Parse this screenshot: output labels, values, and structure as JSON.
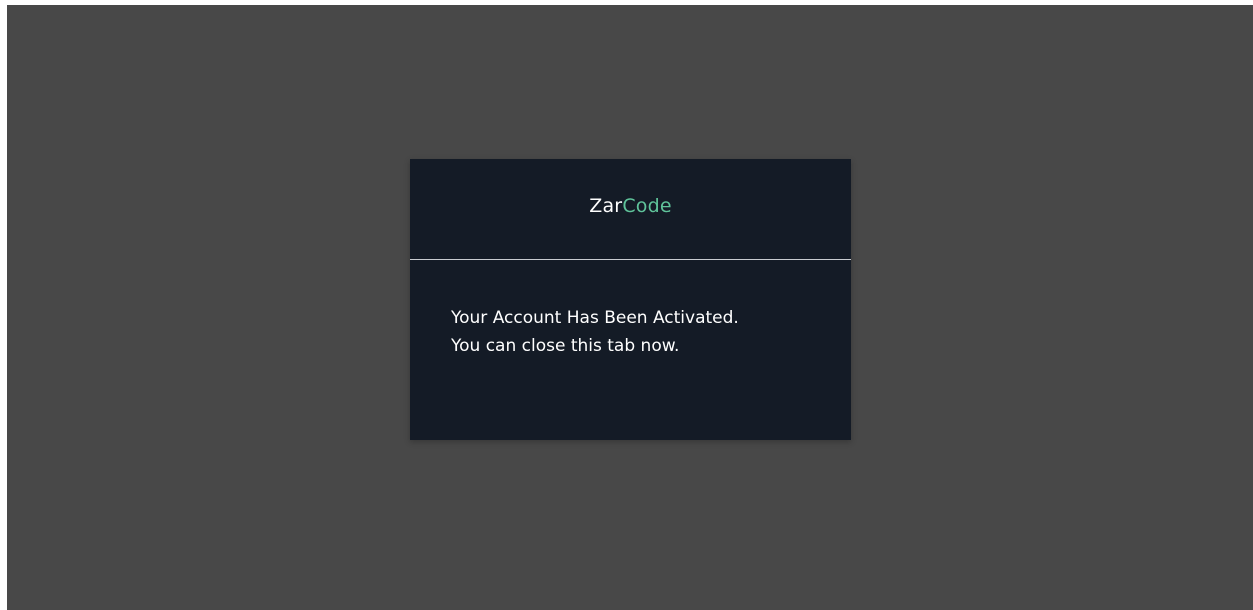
{
  "brand": {
    "part1": "Zar",
    "part2": "Code",
    "accent_color": "#5fc39a"
  },
  "message": {
    "line1": "Your Account Has Been Activated.",
    "line2": "You can close this tab now."
  },
  "colors": {
    "background": "#484848",
    "card": "#141b26",
    "divider": "#c9ccd1"
  }
}
